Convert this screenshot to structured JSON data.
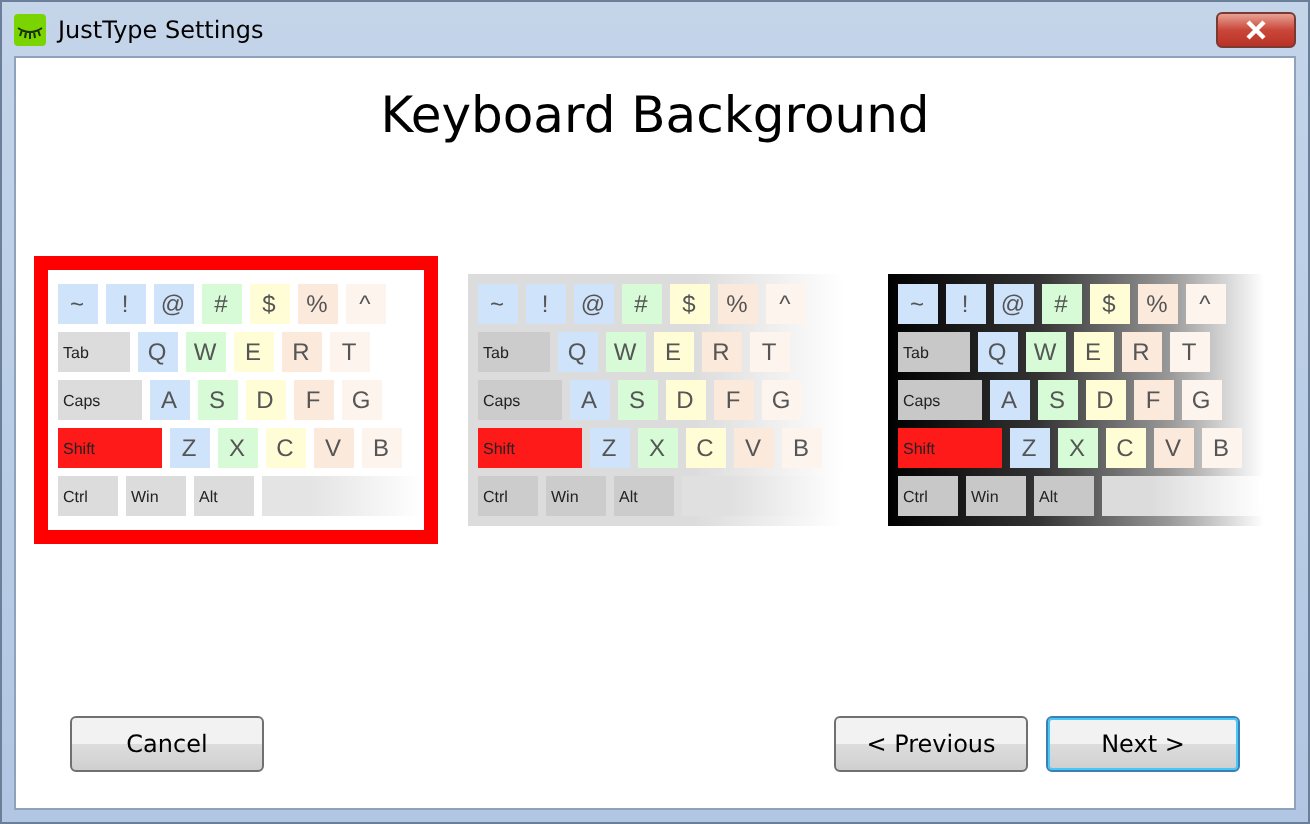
{
  "window": {
    "title": "JustType Settings"
  },
  "heading": "Keyboard Background",
  "previews": [
    {
      "kind": "light",
      "selected": true,
      "rows": [
        [
          {
            "label": "~",
            "kind": "char",
            "color": "#cfe3fb"
          },
          {
            "label": "!",
            "kind": "char",
            "color": "#cfe3fb"
          },
          {
            "label": "@",
            "kind": "char",
            "color": "#cfe3fb"
          },
          {
            "label": "#",
            "kind": "char",
            "color": "#d6fbd6"
          },
          {
            "label": "$",
            "kind": "char",
            "color": "#fffdd6"
          },
          {
            "label": "%",
            "kind": "char",
            "color": "#fbe9dc"
          },
          {
            "label": "^",
            "kind": "char",
            "color": "#fdf4ee"
          }
        ],
        [
          {
            "label": "Tab",
            "kind": "tab",
            "color": "#dcdcdc"
          },
          {
            "label": "Q",
            "kind": "char",
            "color": "#cfe3fb"
          },
          {
            "label": "W",
            "kind": "char",
            "color": "#d6fbd6"
          },
          {
            "label": "E",
            "kind": "char",
            "color": "#fffdd6"
          },
          {
            "label": "R",
            "kind": "char",
            "color": "#fbe9dc"
          },
          {
            "label": "T",
            "kind": "char",
            "color": "#fdf4ee"
          }
        ],
        [
          {
            "label": "Caps",
            "kind": "caps",
            "color": "#dcdcdc"
          },
          {
            "label": "A",
            "kind": "char",
            "color": "#cfe3fb"
          },
          {
            "label": "S",
            "kind": "char",
            "color": "#d6fbd6"
          },
          {
            "label": "D",
            "kind": "char",
            "color": "#fffdd6"
          },
          {
            "label": "F",
            "kind": "char",
            "color": "#fbe9dc"
          },
          {
            "label": "G",
            "kind": "char",
            "color": "#fdf4ee"
          }
        ],
        [
          {
            "label": "Shift",
            "kind": "shift",
            "color": "#ff1a1a"
          },
          {
            "label": "Z",
            "kind": "char",
            "color": "#cfe3fb"
          },
          {
            "label": "X",
            "kind": "char",
            "color": "#d6fbd6"
          },
          {
            "label": "C",
            "kind": "char",
            "color": "#fffdd6"
          },
          {
            "label": "V",
            "kind": "char",
            "color": "#fbe9dc"
          },
          {
            "label": "B",
            "kind": "char",
            "color": "#fdf4ee"
          }
        ],
        [
          {
            "label": "Ctrl",
            "kind": "mod",
            "color": "#dcdcdc"
          },
          {
            "label": "Win",
            "kind": "mod",
            "color": "#dcdcdc"
          },
          {
            "label": "Alt",
            "kind": "mod",
            "color": "#dcdcdc"
          },
          {
            "kind": "space",
            "color": "#e4e4e4"
          }
        ]
      ]
    },
    {
      "kind": "grey",
      "selected": false,
      "rows": [
        [
          {
            "label": "~",
            "kind": "char",
            "color": "#cfe3fb"
          },
          {
            "label": "!",
            "kind": "char",
            "color": "#cfe3fb"
          },
          {
            "label": "@",
            "kind": "char",
            "color": "#cfe3fb"
          },
          {
            "label": "#",
            "kind": "char",
            "color": "#d6fbd6"
          },
          {
            "label": "$",
            "kind": "char",
            "color": "#fffdd6"
          },
          {
            "label": "%",
            "kind": "char",
            "color": "#fbe9dc"
          },
          {
            "label": "^",
            "kind": "char",
            "color": "#fdf4ee"
          }
        ],
        [
          {
            "label": "Tab",
            "kind": "tab",
            "color": "#cccccc"
          },
          {
            "label": "Q",
            "kind": "char",
            "color": "#cfe3fb"
          },
          {
            "label": "W",
            "kind": "char",
            "color": "#d6fbd6"
          },
          {
            "label": "E",
            "kind": "char",
            "color": "#fffdd6"
          },
          {
            "label": "R",
            "kind": "char",
            "color": "#fbe9dc"
          },
          {
            "label": "T",
            "kind": "char",
            "color": "#fdf4ee"
          }
        ],
        [
          {
            "label": "Caps",
            "kind": "caps",
            "color": "#cccccc"
          },
          {
            "label": "A",
            "kind": "char",
            "color": "#cfe3fb"
          },
          {
            "label": "S",
            "kind": "char",
            "color": "#d6fbd6"
          },
          {
            "label": "D",
            "kind": "char",
            "color": "#fffdd6"
          },
          {
            "label": "F",
            "kind": "char",
            "color": "#fbe9dc"
          },
          {
            "label": "G",
            "kind": "char",
            "color": "#fdf4ee"
          }
        ],
        [
          {
            "label": "Shift",
            "kind": "shift",
            "color": "#ff1a1a"
          },
          {
            "label": "Z",
            "kind": "char",
            "color": "#cfe3fb"
          },
          {
            "label": "X",
            "kind": "char",
            "color": "#d6fbd6"
          },
          {
            "label": "C",
            "kind": "char",
            "color": "#fffdd6"
          },
          {
            "label": "V",
            "kind": "char",
            "color": "#fbe9dc"
          },
          {
            "label": "B",
            "kind": "char",
            "color": "#fdf4ee"
          }
        ],
        [
          {
            "label": "Ctrl",
            "kind": "mod",
            "color": "#cccccc"
          },
          {
            "label": "Win",
            "kind": "mod",
            "color": "#cccccc"
          },
          {
            "label": "Alt",
            "kind": "mod",
            "color": "#cccccc"
          },
          {
            "kind": "space",
            "color": "#e0e0e0"
          }
        ]
      ]
    },
    {
      "kind": "dark",
      "selected": false,
      "rows": [
        [
          {
            "label": "~",
            "kind": "char",
            "color": "#cfe3fb"
          },
          {
            "label": "!",
            "kind": "char",
            "color": "#cfe3fb"
          },
          {
            "label": "@",
            "kind": "char",
            "color": "#cfe3fb"
          },
          {
            "label": "#",
            "kind": "char",
            "color": "#d6fbd6"
          },
          {
            "label": "$",
            "kind": "char",
            "color": "#fffdd6"
          },
          {
            "label": "%",
            "kind": "char",
            "color": "#fbe9dc"
          },
          {
            "label": "^",
            "kind": "char",
            "color": "#fdf4ee"
          }
        ],
        [
          {
            "label": "Tab",
            "kind": "tab",
            "color": "#c8c8c8"
          },
          {
            "label": "Q",
            "kind": "char",
            "color": "#cfe3fb"
          },
          {
            "label": "W",
            "kind": "char",
            "color": "#d6fbd6"
          },
          {
            "label": "E",
            "kind": "char",
            "color": "#fffdd6"
          },
          {
            "label": "R",
            "kind": "char",
            "color": "#fbe9dc"
          },
          {
            "label": "T",
            "kind": "char",
            "color": "#fdf4ee"
          }
        ],
        [
          {
            "label": "Caps",
            "kind": "caps",
            "color": "#c8c8c8"
          },
          {
            "label": "A",
            "kind": "char",
            "color": "#cfe3fb"
          },
          {
            "label": "S",
            "kind": "char",
            "color": "#d6fbd6"
          },
          {
            "label": "D",
            "kind": "char",
            "color": "#fffdd6"
          },
          {
            "label": "F",
            "kind": "char",
            "color": "#fbe9dc"
          },
          {
            "label": "G",
            "kind": "char",
            "color": "#fdf4ee"
          }
        ],
        [
          {
            "label": "Shift",
            "kind": "shift",
            "color": "#ff1a1a"
          },
          {
            "label": "Z",
            "kind": "char",
            "color": "#cfe3fb"
          },
          {
            "label": "X",
            "kind": "char",
            "color": "#d6fbd6"
          },
          {
            "label": "C",
            "kind": "char",
            "color": "#fffdd6"
          },
          {
            "label": "V",
            "kind": "char",
            "color": "#fbe9dc"
          },
          {
            "label": "B",
            "kind": "char",
            "color": "#fdf4ee"
          }
        ],
        [
          {
            "label": "Ctrl",
            "kind": "mod",
            "color": "#c8c8c8"
          },
          {
            "label": "Win",
            "kind": "mod",
            "color": "#c8c8c8"
          },
          {
            "label": "Alt",
            "kind": "mod",
            "color": "#c8c8c8"
          },
          {
            "kind": "space",
            "color": "#dcdcdc"
          }
        ]
      ]
    }
  ],
  "buttons": [
    {
      "label": "Cancel",
      "kind": "cancel"
    },
    {
      "label": "< Previous",
      "kind": "nav"
    },
    {
      "label": "Next >",
      "kind": "default"
    }
  ]
}
